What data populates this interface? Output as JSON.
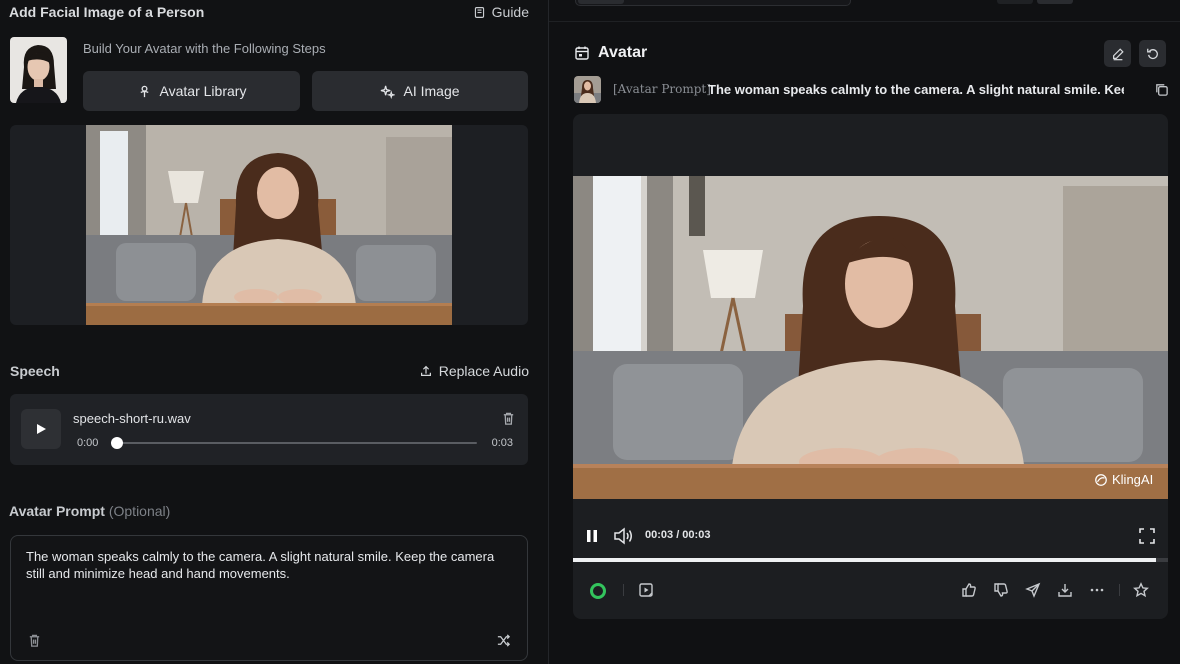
{
  "left_panel": {
    "title": "Add Facial Image of a Person",
    "guide_label": "Guide",
    "steps_label": "Build Your Avatar with the Following Steps",
    "avatar_library_label": "Avatar Library",
    "ai_image_label": "AI Image",
    "speech": {
      "label": "Speech",
      "replace_audio_label": "Replace Audio",
      "file_name": "speech-short-ru.wav",
      "time_start": "0:00",
      "time_end": "0:03",
      "progress": 0.0
    },
    "prompt": {
      "label": "Avatar Prompt",
      "optional_label": "(Optional)",
      "text": "The woman speaks calmly to the camera. A slight natural smile. Keep the camera still and minimize head and hand movements."
    }
  },
  "right_panel": {
    "title": "Avatar",
    "prompt_tag": "[Avatar Prompt]",
    "prompt_text": "The woman speaks calmly to the camera. A slight natural smile. Keep",
    "watermark": "KlingAI",
    "time_display": "00:03 / 00:03",
    "progress": 0.98,
    "status_color": "#33c45d"
  },
  "icons": {
    "guide": "book-icon",
    "avatar_library": "person-pin-icon",
    "ai_image": "sparkle-icon",
    "replace_audio": "upload-icon",
    "play": "play-icon",
    "trash": "trash-icon",
    "shuffle": "shuffle-icon",
    "avatar_header": "calendar-icon",
    "edit": "pencil-icon",
    "reset": "reset-icon",
    "copy": "copy-icon",
    "pause": "pause-icon",
    "volume": "volume-icon",
    "fullscreen": "fullscreen-icon",
    "like": "thumbs-up-icon",
    "dislike": "thumbs-down-icon",
    "share": "send-icon",
    "download": "download-icon",
    "more": "more-icon",
    "favorite": "star-icon"
  }
}
